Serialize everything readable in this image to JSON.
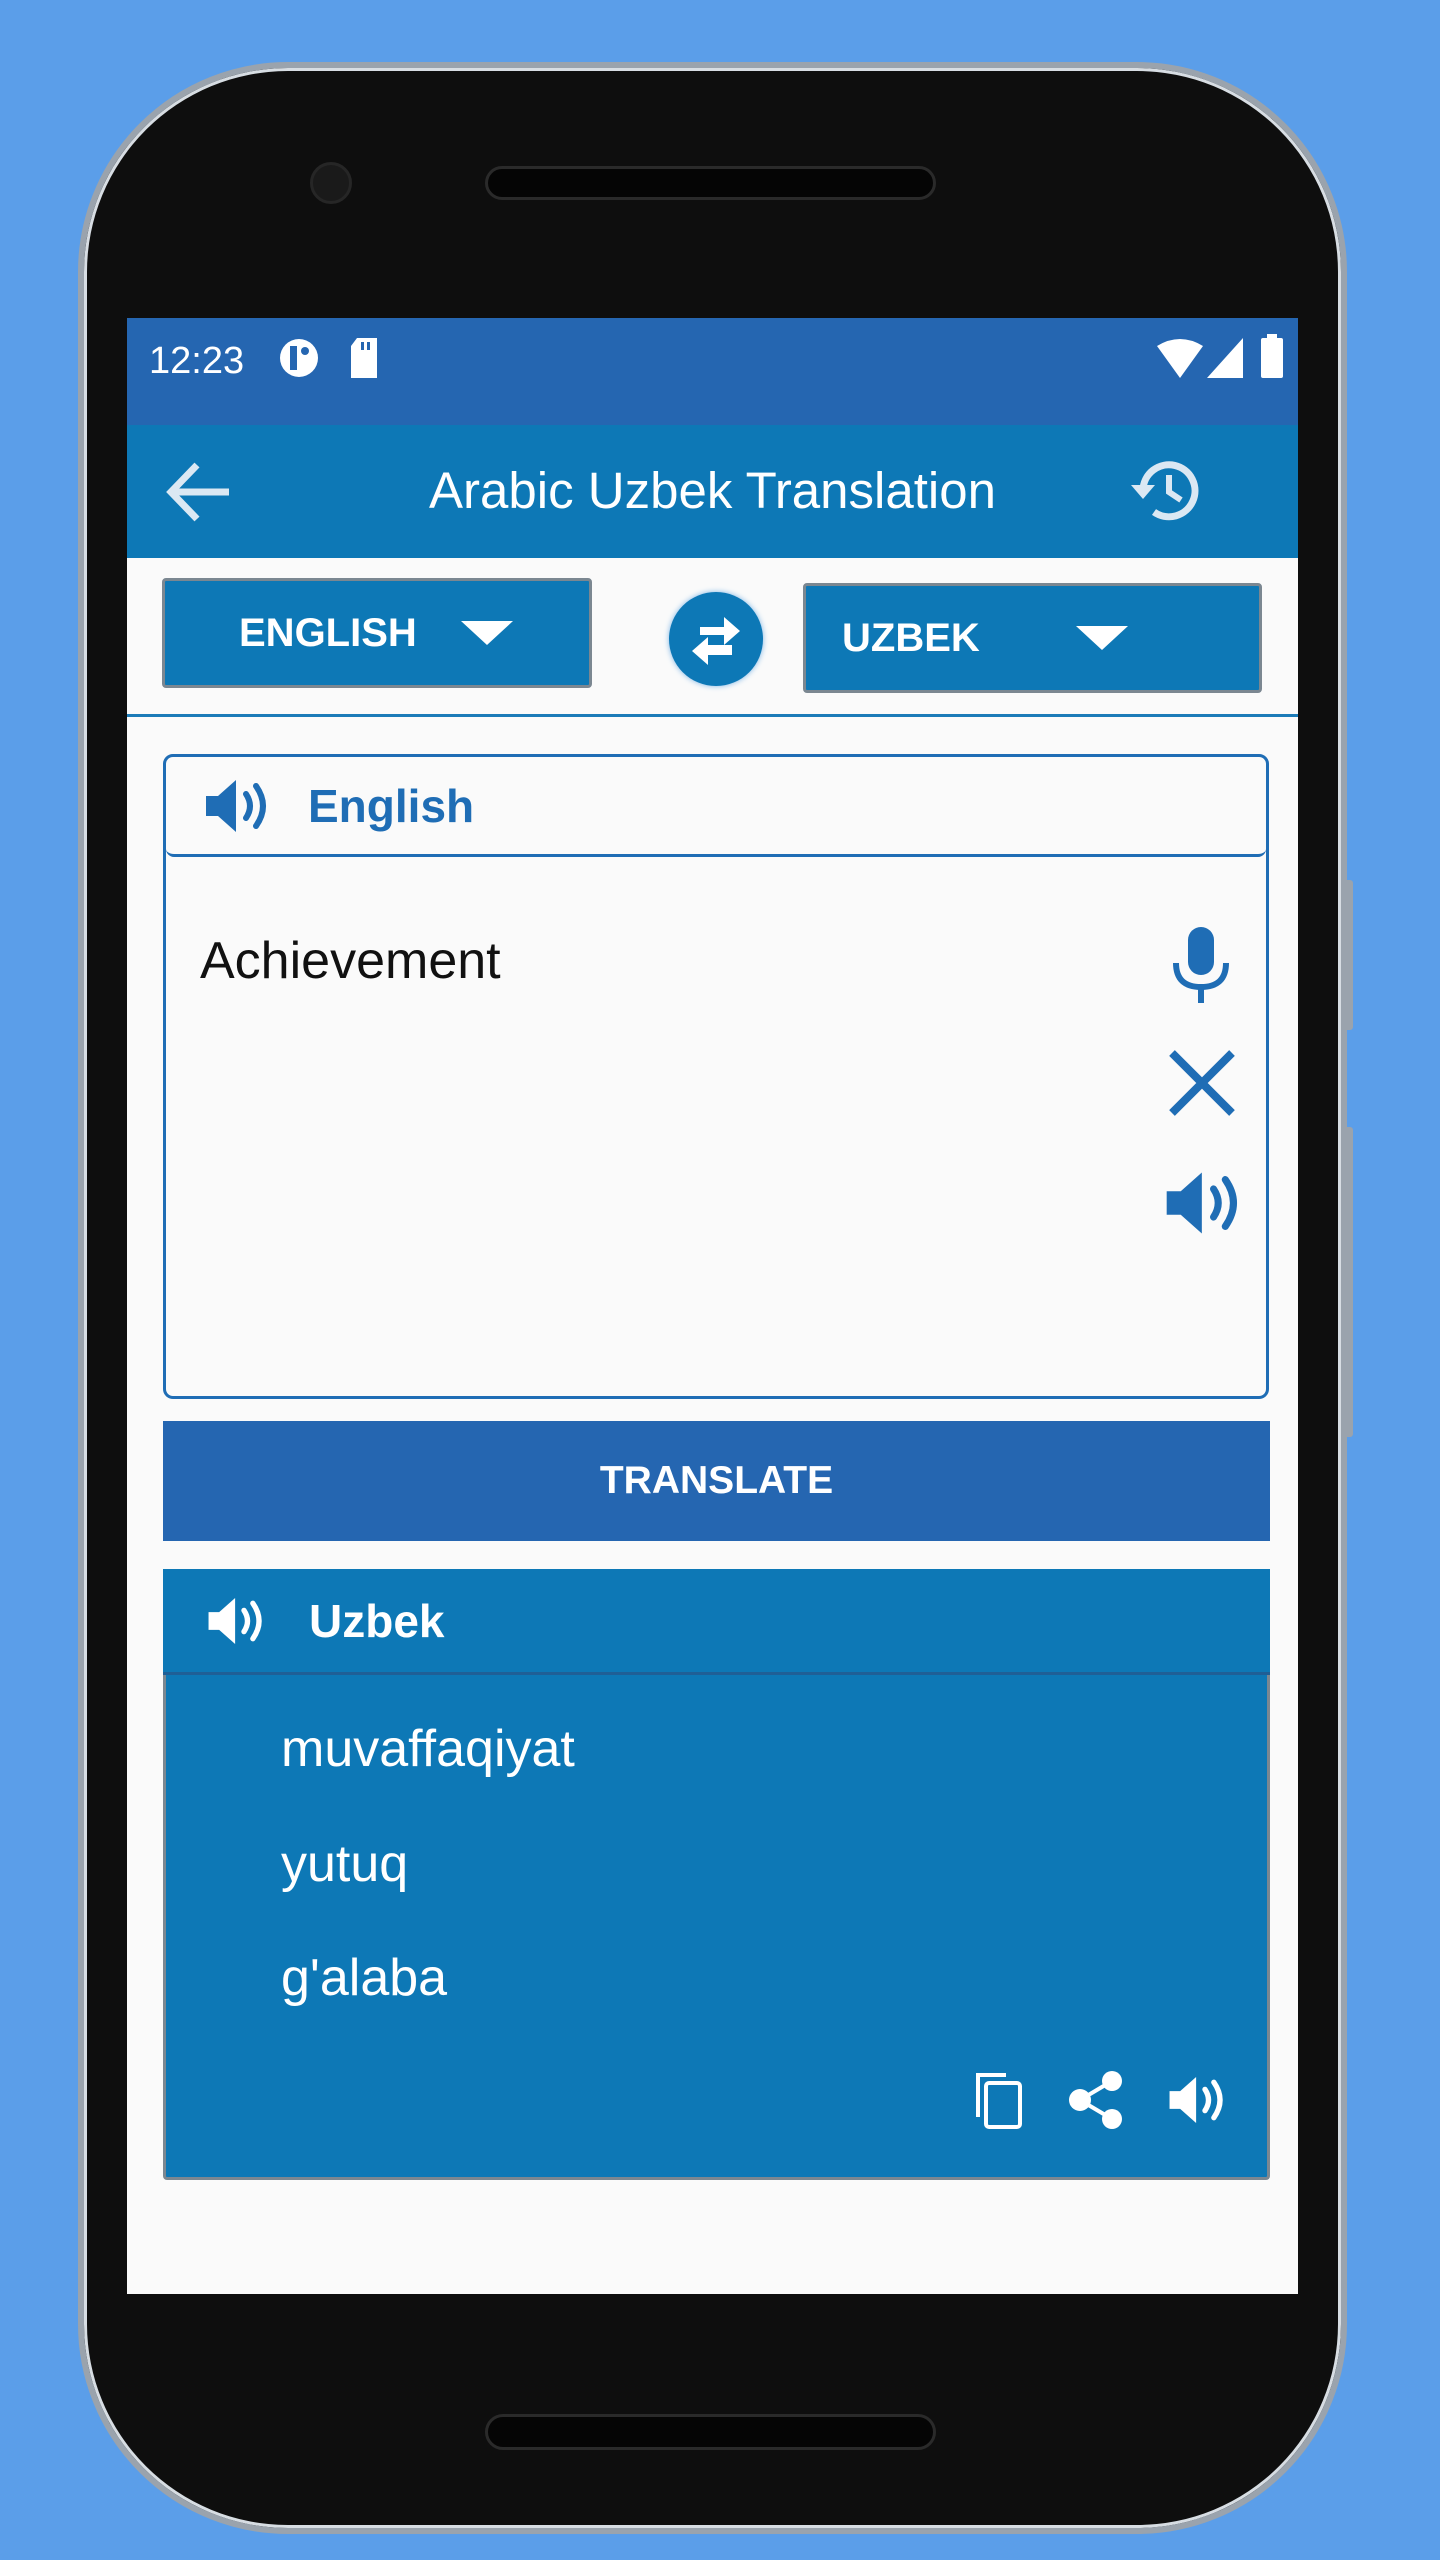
{
  "status_bar": {
    "time": "12:23"
  },
  "app_bar": {
    "title": "Arabic Uzbek Translation"
  },
  "languages": {
    "source": "ENGLISH",
    "target": "UZBEK"
  },
  "input_card": {
    "header": "English",
    "text": "Achievement"
  },
  "translate_button": "TRANSLATE",
  "output_card": {
    "header": "Uzbek",
    "results": [
      "muvaffaqiyat",
      "yutuq",
      "g'alaba"
    ]
  },
  "colors": {
    "background": "#5b9ee9",
    "status_bar": "#2566b1",
    "primary": "#0d78b6",
    "button": "#2566b1",
    "accent_text": "#1f6db5"
  }
}
